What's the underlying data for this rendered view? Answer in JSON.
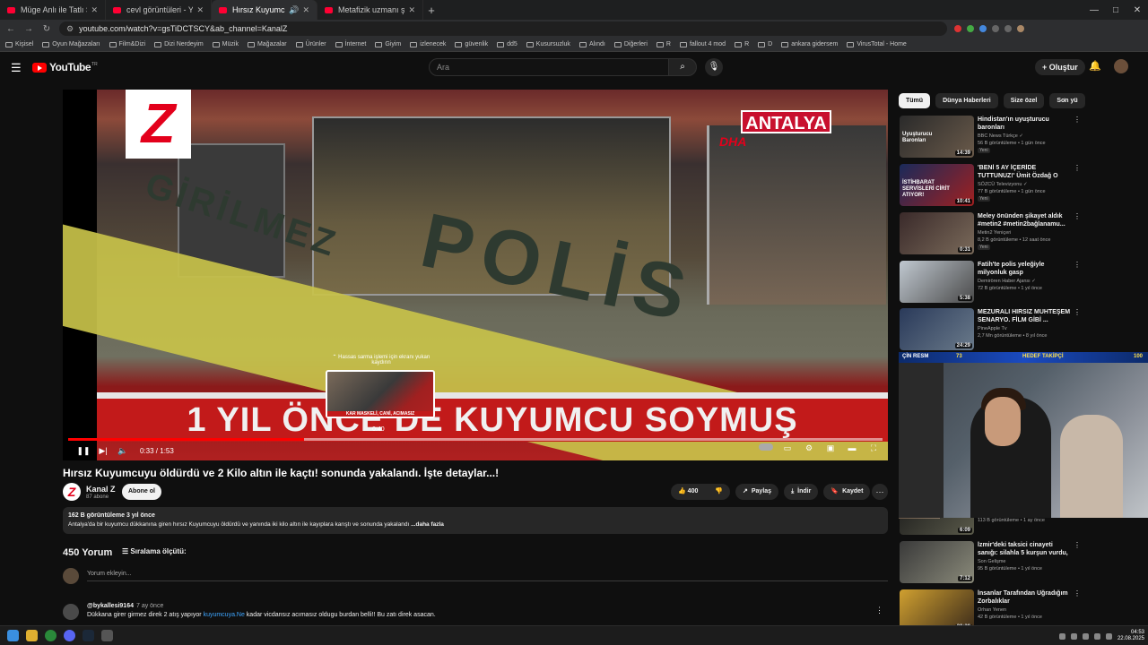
{
  "browser": {
    "tabs": [
      {
        "title": "Müge Anlı ile Tatlı Sert - YouTube",
        "active": false
      },
      {
        "title": "cevl görüntüleri - YouTube",
        "active": false
      },
      {
        "title": "Hırsız Kuyumcuyu öldürdü",
        "active": true
      },
      {
        "title": "Metafizik uzmanı şaşkınlığını gi",
        "active": false
      }
    ],
    "url": "youtube.com/watch?v=gsTiDCTSCY&ab_channel=KanalZ",
    "bookmarks": [
      "Kişisel",
      "Oyun Mağazaları",
      "Film&Dizi",
      "Dizi Nerdeyim",
      "Müzik",
      "Mağazalar",
      "Ürünler",
      "İnternet",
      "Giyim",
      "izlenecek",
      "güvenlik",
      "dd5",
      "Kusursuzluk",
      "Alındı",
      "Diğerleri",
      "R",
      "fallout 4 mod",
      "R",
      "D",
      "ankara gidersem",
      "VirusTotal - Home"
    ]
  },
  "youtube": {
    "logo_text": "YouTube",
    "logo_region": "TR",
    "search_placeholder": "Ara",
    "create_label": "Oluştur"
  },
  "player": {
    "overlay_logo": "Z",
    "city_badge": "ANTALYA",
    "agency": "DHA",
    "tape_text": "POLİS",
    "tape_text2": "GİRİLMEZ",
    "lower_third": "1 YIL ÖNCE DE KUYUMCU SOYMUŞ",
    "scrub_tip": "Hassas sarma işlemi için ekranı yukarı kaydırın",
    "scrub_mini": "KAR MASKELİ, CANİ, ACIMASIZ",
    "scrub_time": "0:40",
    "current_time": "0:33",
    "duration": "1:53",
    "progress_fraction": 0.29
  },
  "video": {
    "title": "Hırsız Kuyumcuyu öldürdü ve 2 Kilo altın ile kaçtı! sonunda yakalandı. İşte detaylar...!",
    "channel_initial": "Z",
    "channel_name": "Kanal Z",
    "subscribers": "87 abone",
    "subscribe_label": "Abone ol",
    "likes": "400",
    "share_label": "Paylaş",
    "download_label": "İndir",
    "save_label": "Kaydet",
    "description_meta": "162 B görüntüleme  3 yıl önce",
    "description_text": "Antalya'da bir kuyumcu dükkanına giren hırsız Kuyumcuyu öldürdü ve yanında iki kilo altın ile kayıplara karıştı ve sonunda yakalandı ",
    "description_more": "...daha fazla"
  },
  "comments": {
    "count_label": "450 Yorum",
    "sort_label": "Sıralama ölçütü:",
    "add_placeholder": "Yorum ekleyin...",
    "items": [
      {
        "author": "@bykallesi9164",
        "time": "7 ay önce",
        "text_before": "Dükkana girer girmez direk 2 atış yapıyor ",
        "link": "kuyumcuya.Ne",
        "text_after": " kadar vicdansız acımasız oldugu burdan belli!! Bu zatı direk asacan."
      }
    ]
  },
  "sidebar": {
    "chips": [
      "Tümü",
      "Dünya Haberleri",
      "Size özel",
      "Son yü"
    ],
    "recommendations": [
      {
        "title": "Hindistan'ın uyuşturucu baronları",
        "channel": "BBC News Türkçe ✓",
        "meta": "56 B görüntüleme • 1 gün önce",
        "badge": "Yeni",
        "duration": "14:39",
        "thumb_text": "Uyuşturucu Baronları"
      },
      {
        "title": "'BENİ 5 AY İÇERİDE TUTTUNUZ!' Ümit Özdağ O Belgeleri ...",
        "channel": "SÖZCÜ Televizyonu ✓",
        "meta": "77 B görüntüleme • 1 gün önce",
        "badge": "Yeni",
        "duration": "10:41",
        "thumb_text": "İSTİHBARAT SERVİSLERİ CİRİT ATIYOR!"
      },
      {
        "title": "Meley önünden şikayet aldık #metin2 #metin2bağlanamu...",
        "channel": "Metin2 Yeniçeri",
        "meta": "8,2 B görüntüleme • 12 saat önce",
        "badge": "Yeni",
        "duration": "0:31",
        "thumb_text": ""
      },
      {
        "title": "Fatih'te polis yeleğiyle milyonluk gasp",
        "channel": "Demirören Haber Ajansı ✓",
        "meta": "72 B görüntüleme • 1 yıl önce",
        "badge": "",
        "duration": "5:38",
        "thumb_text": ""
      },
      {
        "title": "MEZURALI HIRSIZ MUHTEŞEM SENARYO. FİLM GİBİ ...",
        "channel": "PineApple Tv",
        "meta": "2,7 Mn görüntüleme • 8 yıl önce",
        "badge": "",
        "duration": "24:29",
        "thumb_text": ""
      },
      {
        "title": "",
        "channel": "Son Gelişme",
        "meta": "113 B görüntüleme • 1 ay önce",
        "badge": "",
        "duration": "6:09",
        "thumb_text": ""
      },
      {
        "title": "İzmir'deki taksici cinayeti sanığı: silahla 5 kurşun vurdu, 3'ünü ...",
        "channel": "Son Gelişme",
        "meta": "95 B görüntüleme • 1 yıl önce",
        "badge": "",
        "duration": "7:12",
        "thumb_text": ""
      },
      {
        "title": "İnsanlar Tarafından Uğradığım Zorbalıklar",
        "channel": "Orhan Yenen",
        "meta": "42 B görüntüleme • 1 yıl önce",
        "badge": "",
        "duration": "28:38",
        "thumb_text": ""
      }
    ]
  },
  "webcam": {
    "left_label": "ÇİN RESM",
    "count_left": "73",
    "center_label": "HEDEF TAKİPÇİ",
    "count_right": "100"
  },
  "taskbar": {
    "time": "04:53",
    "date": "22.08.2025"
  },
  "colors": {
    "yt_red": "#ff0000",
    "kanalz_red": "#e3001b",
    "link_blue": "#3ea6ff"
  }
}
